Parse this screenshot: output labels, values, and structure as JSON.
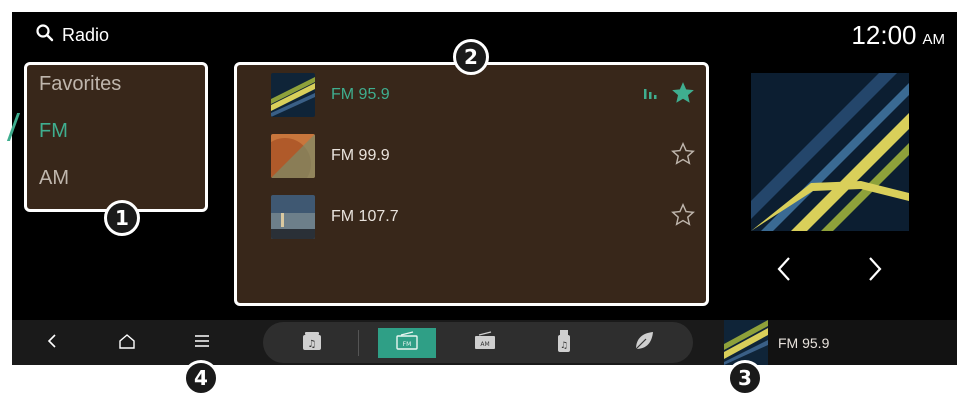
{
  "header": {
    "title": "Radio",
    "time": "12:00",
    "ampm": "AM"
  },
  "categories": [
    {
      "label": "Favorites",
      "active": false
    },
    {
      "label": "FM",
      "active": true
    },
    {
      "label": "AM",
      "active": false
    }
  ],
  "stations": [
    {
      "label": "FM 95.9",
      "playing": true,
      "favorite": true
    },
    {
      "label": "FM 99.9",
      "playing": false,
      "favorite": false
    },
    {
      "label": "FM 107.7",
      "playing": false,
      "favorite": false
    }
  ],
  "sources": [
    {
      "label": "",
      "icon": "radio-music-icon"
    },
    {
      "label": "FM",
      "icon": "fm-icon"
    },
    {
      "label": "AM",
      "icon": "am-icon"
    },
    {
      "label": "",
      "icon": "usb-music-icon"
    },
    {
      "label": "",
      "icon": "leaf-music-icon"
    }
  ],
  "mini_player": {
    "label": "FM 95.9"
  },
  "callouts": [
    "1",
    "2",
    "3",
    "4"
  ],
  "colors": {
    "accent": "#3fae8f",
    "panel": "#38271a",
    "background": "#000000"
  }
}
